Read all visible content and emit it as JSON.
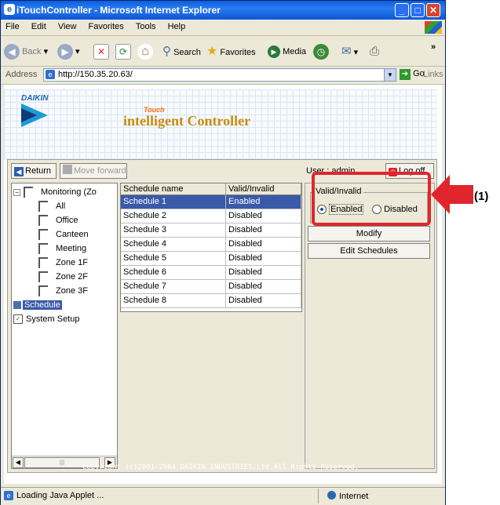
{
  "window": {
    "title": "iTouchController - Microsoft Internet Explorer"
  },
  "menu": [
    "File",
    "Edit",
    "View",
    "Favorites",
    "Tools",
    "Help"
  ],
  "toolbar": {
    "back": "Back",
    "search": "Search",
    "favorites": "Favorites",
    "media": "Media",
    "more": "»"
  },
  "address": {
    "label": "Address",
    "url": "http://150.35.20.63/",
    "go": "Go",
    "links": "Links"
  },
  "banner": {
    "brand": "DAIKIN",
    "product": "intelligent Controller",
    "product_tag": "Touch"
  },
  "applet": {
    "return_label": "Return",
    "move_forward_label": "Move forward",
    "user": "User : admin",
    "logoff_label": "Log off",
    "tree": [
      {
        "label": "Monitoring (Zo",
        "level": 0
      },
      {
        "label": "All",
        "level": 1
      },
      {
        "label": "Office",
        "level": 1
      },
      {
        "label": "Canteen",
        "level": 1
      },
      {
        "label": "Meeting",
        "level": 1
      },
      {
        "label": "Zone 1F",
        "level": 1
      },
      {
        "label": "Zone 2F",
        "level": 1
      },
      {
        "label": "Zone 3F",
        "level": 1
      },
      {
        "label": "Schedule",
        "level": 0,
        "selected": true
      },
      {
        "label": "System Setup",
        "level": 0
      }
    ],
    "table": {
      "columns": [
        "Schedule name",
        "Valid/Invalid"
      ],
      "rows": [
        [
          "Schedule 1",
          "Enabled"
        ],
        [
          "Schedule 2",
          "Disabled"
        ],
        [
          "Schedule 3",
          "Disabled"
        ],
        [
          "Schedule 4",
          "Disabled"
        ],
        [
          "Schedule 5",
          "Disabled"
        ],
        [
          "Schedule 6",
          "Disabled"
        ],
        [
          "Schedule 7",
          "Disabled"
        ],
        [
          "Schedule 8",
          "Disabled"
        ]
      ],
      "selected_row": 0
    },
    "valid_group": {
      "label": "Valid/Invalid",
      "enabled": "Enabled",
      "disabled": "Disabled",
      "selected": "Enabled"
    },
    "modify_label": "Modify",
    "edit_schedules_label": "Edit Schedules",
    "copyright": "Copyright (c)2001-2004 DAIKIN INDUSTRIES,Ltd.All Rights Reserved."
  },
  "status": {
    "text": "Loading Java Applet ...",
    "zone": "Internet"
  },
  "annotation": {
    "label": "(1)"
  },
  "colors": {
    "selection": "#3a59a8",
    "highlight": "#e0262c",
    "titlebar": "#0a5fdd"
  }
}
